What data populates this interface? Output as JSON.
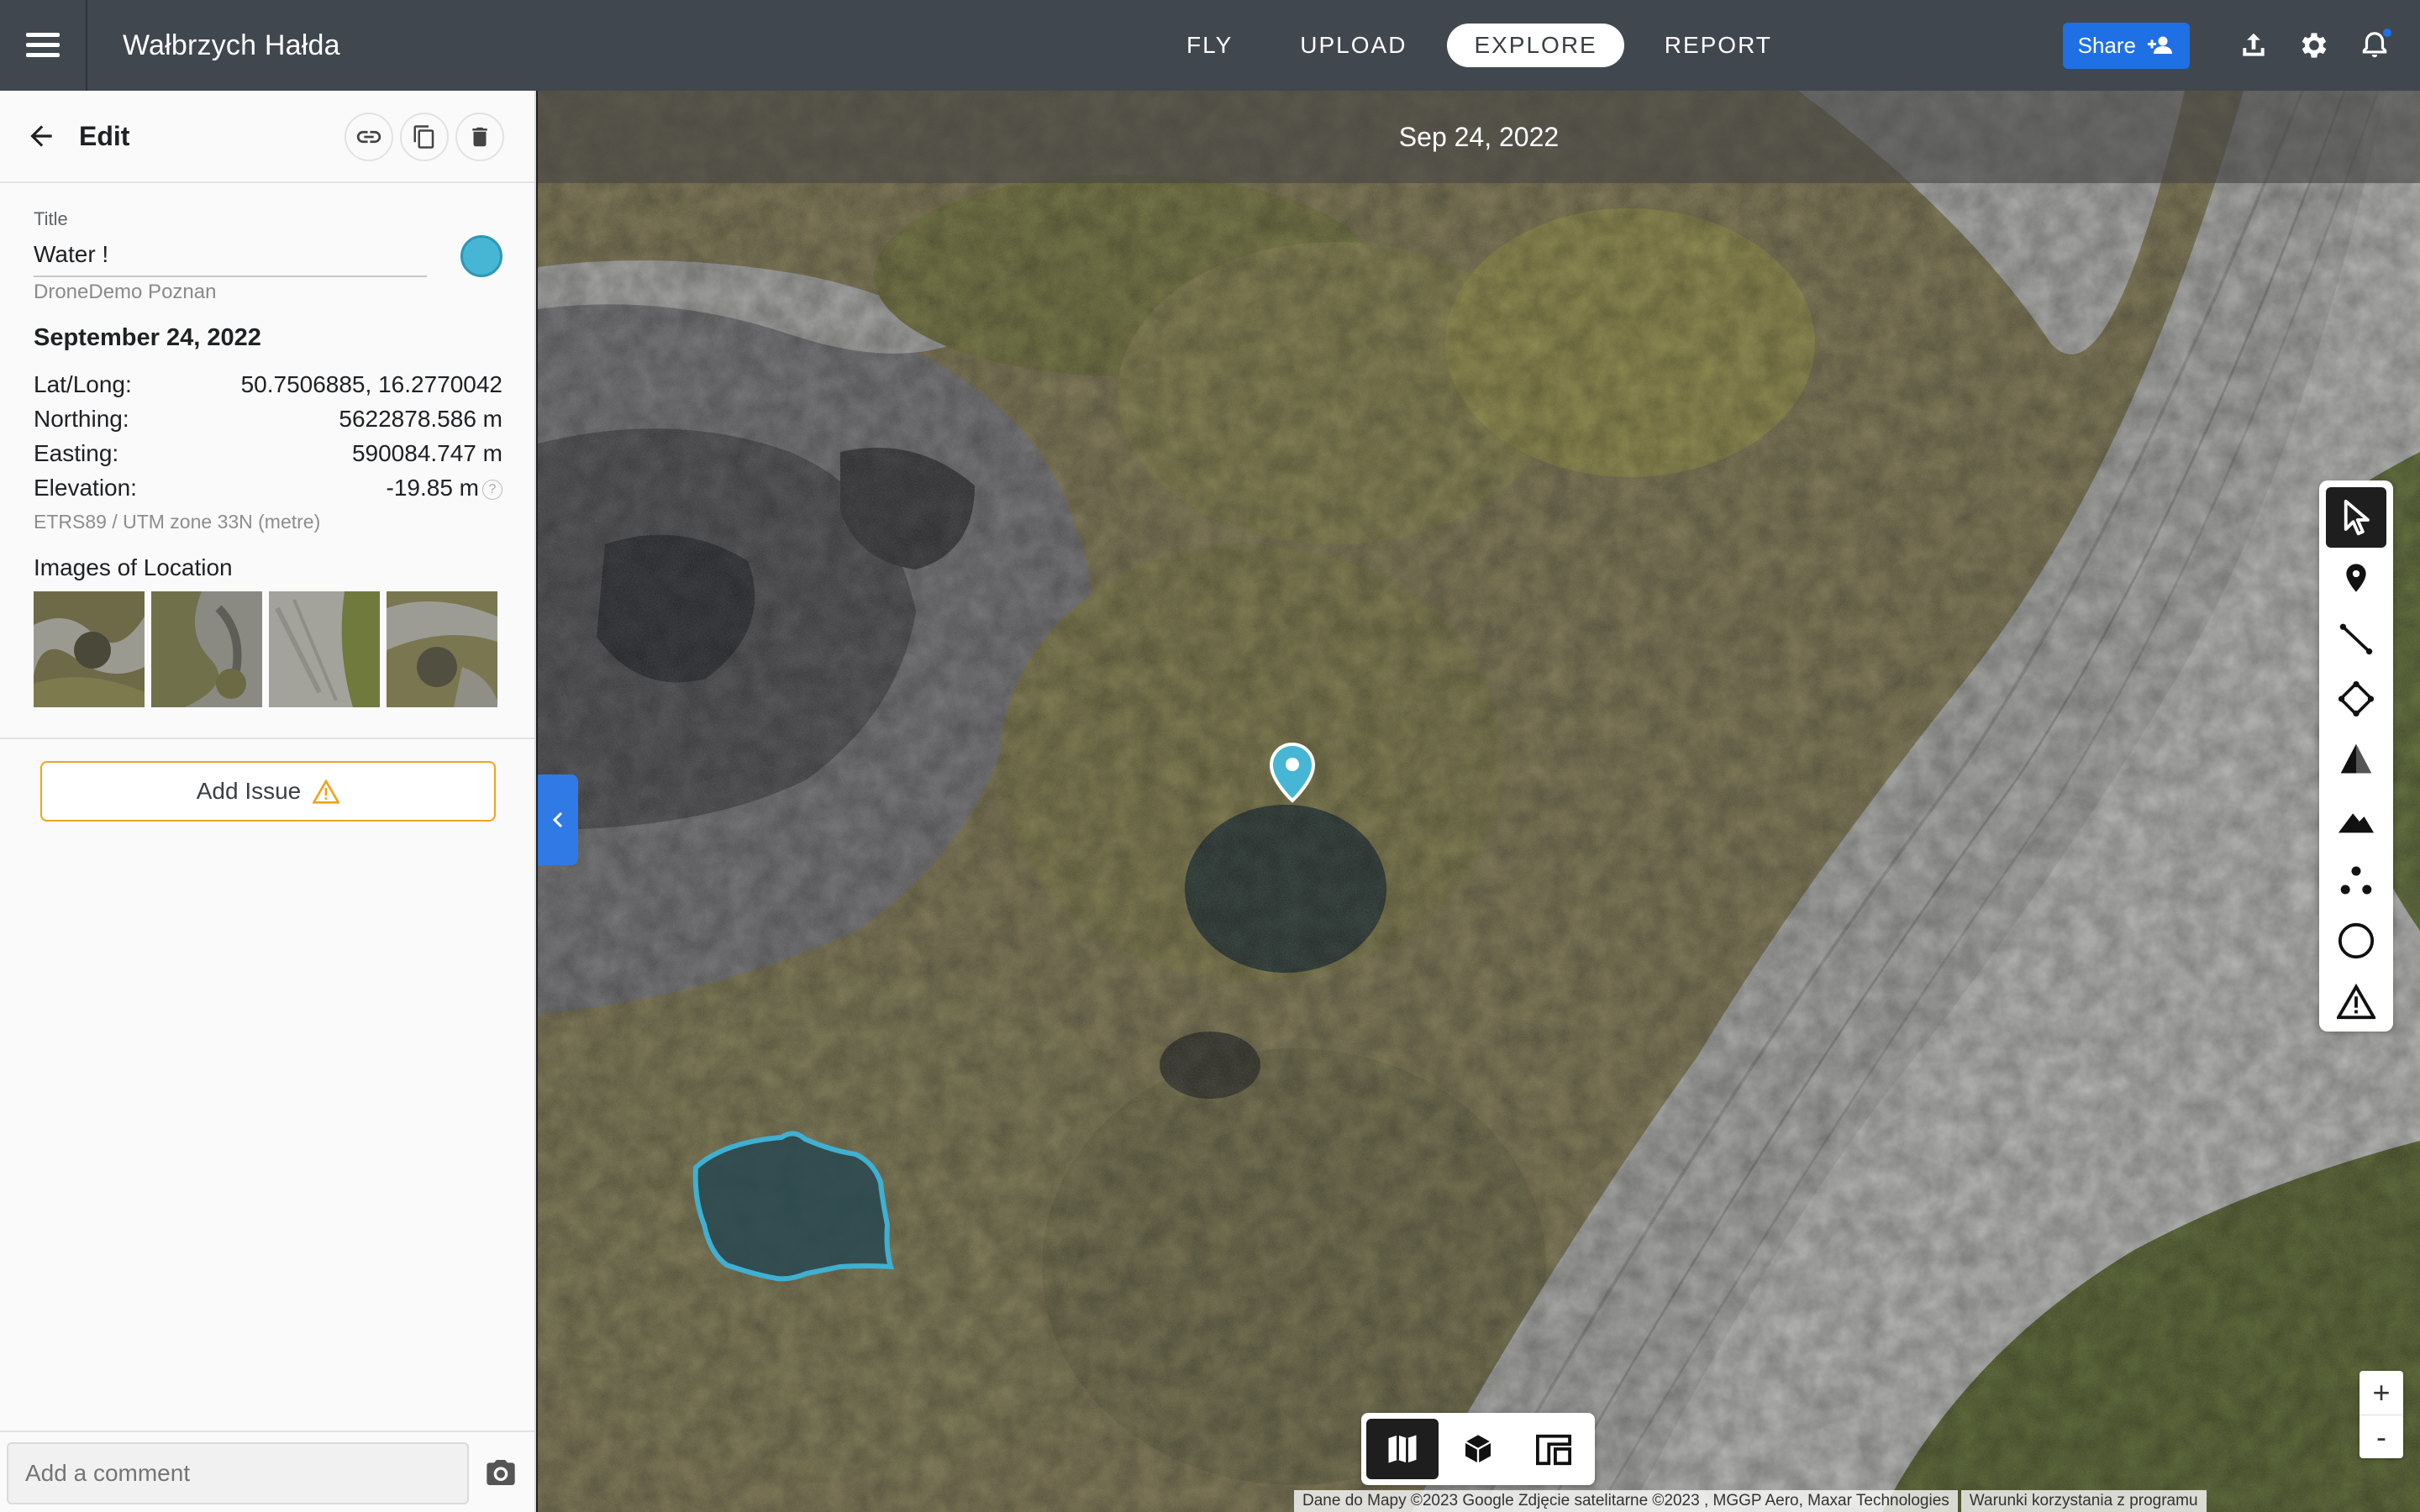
{
  "header": {
    "project_title": "Wałbrzych Hałda",
    "nav": [
      {
        "label": "FLY",
        "active": false
      },
      {
        "label": "UPLOAD",
        "active": false
      },
      {
        "label": "EXPLORE",
        "active": true
      },
      {
        "label": "REPORT",
        "active": false
      }
    ],
    "share_label": "Share",
    "icons": [
      "menu-icon",
      "share-people-icon",
      "upload-icon",
      "gear-icon",
      "bell-icon"
    ]
  },
  "sidebar": {
    "header_title": "Edit",
    "header_actions": [
      "link-icon",
      "copy-icon",
      "trash-icon"
    ],
    "title_label": "Title",
    "title_value": "Water !",
    "marker_color": "#47b6d4",
    "owner": "DroneDemo Poznan",
    "date": "September 24, 2022",
    "coords": [
      {
        "label": "Lat/Long:",
        "value": "50.7506885, 16.2770042"
      },
      {
        "label": "Northing:",
        "value": "5622878.586 m"
      },
      {
        "label": "Easting:",
        "value": "590084.747 m"
      },
      {
        "label": "Elevation:",
        "value": "-19.85 m"
      }
    ],
    "crs": "ETRS89 / UTM zone 33N (metre)",
    "images_label": "Images of Location",
    "add_issue_label": "Add Issue",
    "comment_placeholder": "Add a comment"
  },
  "map": {
    "date_banner": "Sep 24, 2022",
    "tools": [
      "select-cursor-icon",
      "location-pin-icon",
      "line-measure-icon",
      "polygon-area-icon",
      "volume-icon",
      "elevation-profile-icon",
      "point-cluster-icon",
      "circle-icon",
      "warning-triangle-icon"
    ],
    "view_modes": [
      "map-2d-icon",
      "model-3d-icon",
      "layout-compare-icon"
    ],
    "zoom_in": "+",
    "zoom_out": "-",
    "attribution": "Dane do Mapy ©2023 Google Zdjęcie satelitarne ©2023 , MGGP Aero, Maxar Technologies",
    "terms": "Warunki korzystania z programu",
    "accent_color": "#2f7ae5",
    "polygon_color": "#47b6d4"
  }
}
